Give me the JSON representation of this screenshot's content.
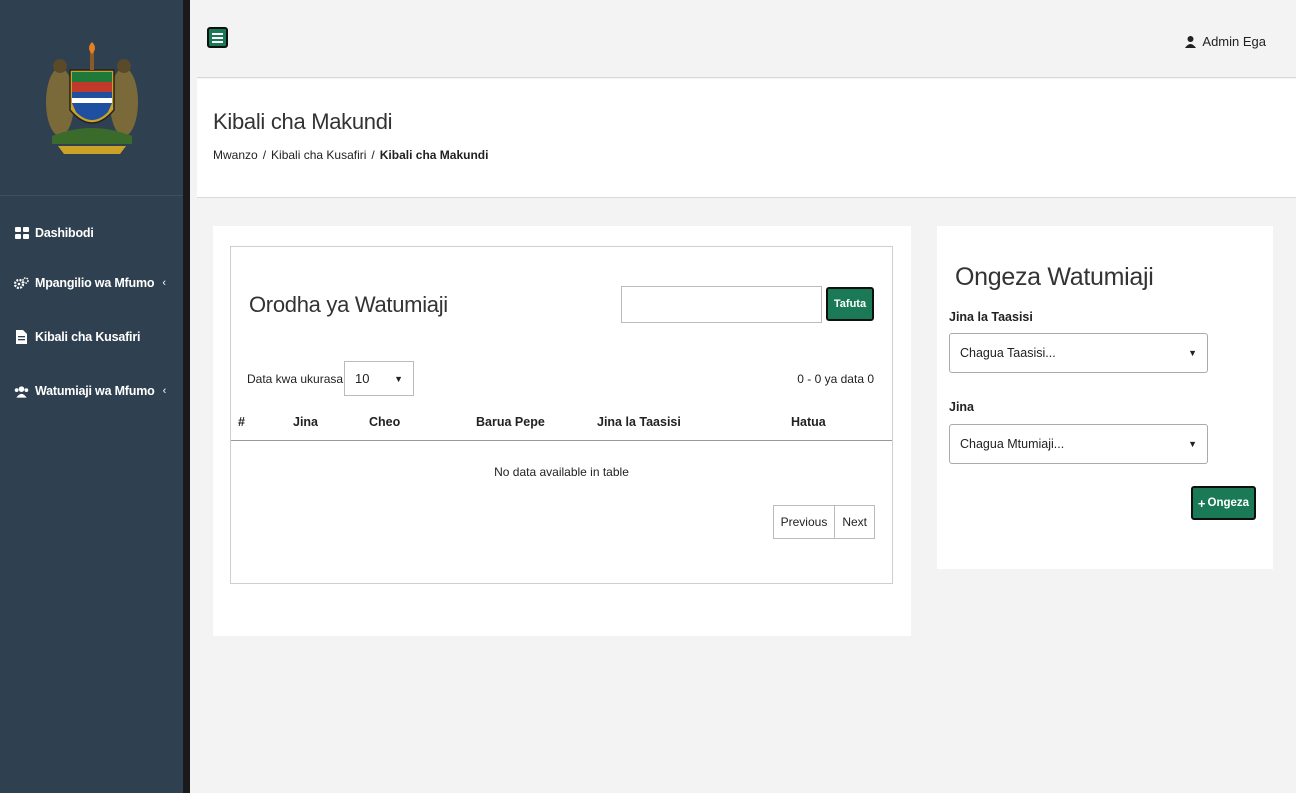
{
  "sidebar": {
    "items": [
      {
        "label": "Dashibodi",
        "icon": "dashboard-icon",
        "has_submenu": false
      },
      {
        "label": "Mpangilio wa Mfumo",
        "icon": "cogs-icon",
        "has_submenu": true
      },
      {
        "label": "Kibali cha Kusafiri",
        "icon": "file-icon",
        "has_submenu": false
      },
      {
        "label": "Watumiaji wa Mfumo",
        "icon": "users-icon",
        "has_submenu": true
      }
    ]
  },
  "topbar": {
    "user_name": "Admin Ega"
  },
  "page": {
    "title": "Kibali cha Makundi",
    "breadcrumb": [
      "Mwanzo",
      "Kibali cha Kusafiri",
      "Kibali cha Makundi"
    ]
  },
  "list_panel": {
    "title": "Orodha ya Watumiaji",
    "search_value": "",
    "search_button": "Tafuta",
    "length_label": "Data kwa ukurasa",
    "length_value": "10",
    "info": "0 - 0 ya data 0",
    "columns": [
      "#",
      "Jina",
      "Cheo",
      "Barua Pepe",
      "Jina la Taasisi",
      "Hatua"
    ],
    "empty_message": "No data available in table",
    "pager_prev": "Previous",
    "pager_next": "Next"
  },
  "add_panel": {
    "title": "Ongeza Watumiaji",
    "institution_label": "Jina la Taasisi",
    "institution_value": "Chagua Taasisi...",
    "name_label": "Jina",
    "name_value": "Chagua Mtumiaji...",
    "add_button": "Ongeza"
  },
  "colors": {
    "sidebar_bg": "#2f4050",
    "accent": "#1a7a55"
  }
}
